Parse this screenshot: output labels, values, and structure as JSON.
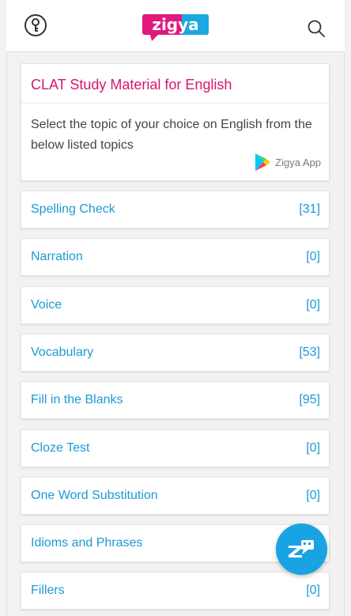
{
  "header": {
    "logo_text": "zigya"
  },
  "intro": {
    "title": "CLAT Study Material for English",
    "description": "Select the topic of your choice on English from the below listed topics",
    "app_label": "Zigya App"
  },
  "topics": [
    {
      "name": "Spelling Check",
      "count": "[31]"
    },
    {
      "name": "Narration",
      "count": "[0]"
    },
    {
      "name": "Voice",
      "count": "[0]"
    },
    {
      "name": "Vocabulary",
      "count": "[53]"
    },
    {
      "name": "Fill in the Blanks",
      "count": "[95]"
    },
    {
      "name": "Cloze Test",
      "count": "[0]"
    },
    {
      "name": "One Word Substitution",
      "count": "[0]"
    },
    {
      "name": "Idioms and Phrases",
      "count": ""
    },
    {
      "name": "Fillers",
      "count": "[0]"
    }
  ],
  "colors": {
    "brand_pink": "#e0197d",
    "link_blue": "#1b9ad6",
    "fab_blue": "#1aa3e2"
  },
  "icons": {
    "key": "key-icon",
    "search": "search-icon",
    "play_store": "play-store-icon",
    "fab": "zigya-chat-icon"
  }
}
